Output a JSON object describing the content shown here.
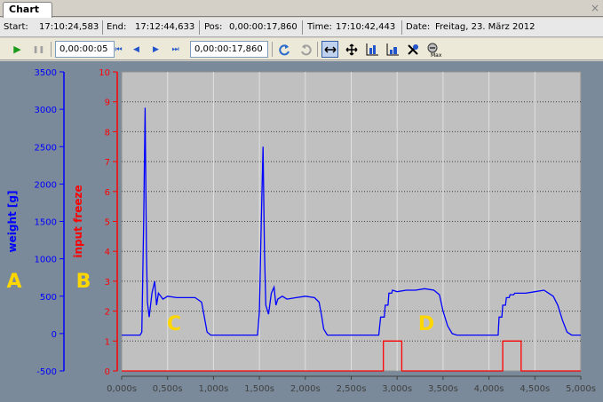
{
  "tab": {
    "label": "Chart",
    "close": "×"
  },
  "infobar": {
    "start_label": "Start:",
    "start_value": "17:10:24,583",
    "end_label": "End:",
    "end_value": "17:12:44,633",
    "pos_label": "Pos:",
    "pos_value": "0,00:00:17,860",
    "time_label": "Time:",
    "time_value": "17:10:42,443",
    "date_label": "Date:",
    "date_value": "Freitag, 23. März 2012"
  },
  "toolbar": {
    "play": "▶",
    "pause": "❚❚",
    "interval_value": "0,00:00:05",
    "prev_end": "⏮",
    "prev": "◀",
    "next": "▶",
    "next_end": "⏭",
    "position_value": "0,00:00:17,860",
    "icons": [
      "play-icon",
      "pause-icon",
      "first-icon",
      "prev-icon",
      "next-icon",
      "last-icon",
      "undo-icon",
      "redo-icon",
      "pan-x-icon",
      "move-icon",
      "zoom-x-icon",
      "zoom-y-icon",
      "no-zoom-icon",
      "zoom-max-icon"
    ]
  },
  "chart_data": {
    "type": "line",
    "x_ticks": [
      "0,000s",
      "0,500s",
      "1,000s",
      "1,500s",
      "2,000s",
      "2,500s",
      "3,000s",
      "3,500s",
      "4,000s",
      "4,500s",
      "5,000s"
    ],
    "xlim": [
      0,
      5
    ],
    "axes": [
      {
        "label": "weight [g]",
        "color": "#0000ff",
        "ylim": [
          -500,
          3500
        ],
        "ticks": [
          "-500",
          "0",
          "500",
          "1000",
          "1500",
          "2000",
          "2500",
          "3000",
          "3500"
        ]
      },
      {
        "label": "input freeze",
        "color": "#ff0000",
        "ylim": [
          0,
          10
        ],
        "ticks": [
          "0",
          "1",
          "2",
          "3",
          "4",
          "5",
          "6",
          "7",
          "8",
          "9",
          "10"
        ]
      }
    ],
    "series": [
      {
        "axis": 1,
        "color": "#0000ff",
        "x": [
          0.0,
          0.2,
          0.22,
          0.24,
          0.255,
          0.27,
          0.28,
          0.3,
          0.33,
          0.36,
          0.38,
          0.4,
          0.45,
          0.5,
          0.6,
          0.7,
          0.8,
          0.87,
          0.9,
          0.93,
          0.97,
          1.0,
          1.1,
          1.2,
          1.3,
          1.48,
          1.5,
          1.52,
          1.54,
          1.555,
          1.57,
          1.6,
          1.63,
          1.66,
          1.68,
          1.7,
          1.75,
          1.8,
          1.9,
          2.0,
          2.1,
          2.15,
          2.18,
          2.2,
          2.24,
          2.28,
          2.3,
          2.4,
          2.6,
          2.8,
          2.82,
          2.83,
          2.86,
          2.87,
          2.9,
          2.91,
          2.94,
          2.95,
          3.0,
          3.1,
          3.2,
          3.3,
          3.4,
          3.46,
          3.5,
          3.55,
          3.6,
          3.65,
          3.7,
          3.8,
          4.0,
          4.1,
          4.11,
          4.14,
          4.15,
          4.18,
          4.19,
          4.22,
          4.23,
          4.27,
          4.28,
          4.4,
          4.5,
          4.6,
          4.65,
          4.7,
          4.75,
          4.8,
          4.85,
          4.9,
          5.0
        ],
        "y": [
          1.2,
          1.2,
          1.3,
          5.0,
          8.8,
          4.0,
          2.3,
          1.8,
          2.6,
          3.0,
          2.2,
          2.6,
          2.4,
          2.5,
          2.45,
          2.45,
          2.45,
          2.3,
          1.8,
          1.3,
          1.2,
          1.2,
          1.2,
          1.2,
          1.2,
          1.2,
          2.0,
          5.0,
          7.5,
          4.0,
          2.2,
          1.9,
          2.6,
          2.8,
          2.2,
          2.4,
          2.5,
          2.4,
          2.45,
          2.5,
          2.45,
          2.3,
          1.8,
          1.4,
          1.2,
          1.2,
          1.2,
          1.2,
          1.2,
          1.2,
          1.8,
          1.8,
          1.8,
          2.2,
          2.2,
          2.6,
          2.6,
          2.7,
          2.65,
          2.7,
          2.7,
          2.75,
          2.7,
          2.55,
          2.0,
          1.5,
          1.25,
          1.2,
          1.2,
          1.2,
          1.2,
          1.2,
          1.8,
          1.8,
          2.2,
          2.2,
          2.45,
          2.45,
          2.55,
          2.55,
          2.6,
          2.6,
          2.65,
          2.7,
          2.6,
          2.5,
          2.2,
          1.7,
          1.3,
          1.2,
          1.2
        ]
      },
      {
        "axis": 2,
        "color": "#ff0000",
        "x": [
          0.0,
          2.85,
          2.85,
          3.05,
          3.05,
          4.15,
          4.15,
          4.35,
          4.35,
          5.0
        ],
        "y": [
          0,
          0,
          1,
          1,
          0,
          0,
          1,
          1,
          0,
          0
        ]
      }
    ],
    "annotations": [
      "A",
      "B",
      "C",
      "D"
    ]
  }
}
